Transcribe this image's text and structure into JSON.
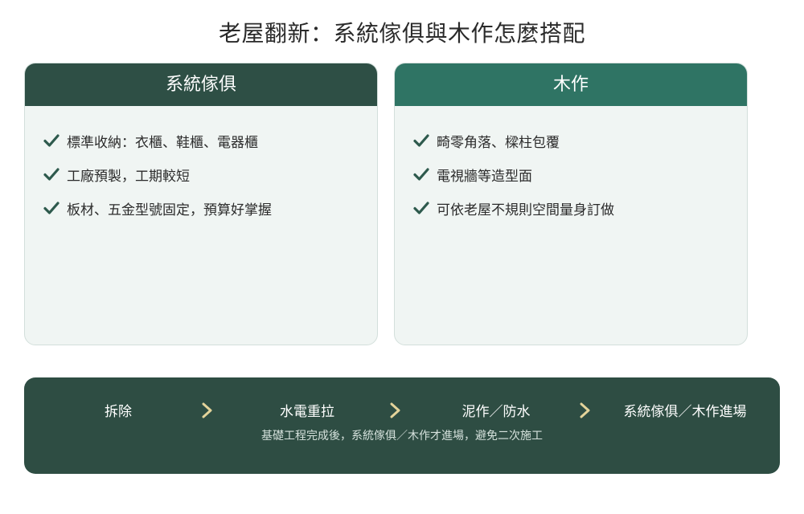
{
  "title": "老屋翻新：系統傢俱與木作怎麼搭配",
  "cards": [
    {
      "heading": "系統傢俱",
      "items": [
        "標準收納：衣櫃、鞋櫃、電器櫃",
        "工廠預製，工期較短",
        "板材、五金型號固定，預算好掌握"
      ]
    },
    {
      "heading": "木作",
      "items": [
        "畸零角落、樑柱包覆",
        "電視牆等造型面",
        "可依老屋不規則空間量身訂做"
      ]
    }
  ],
  "flow": {
    "steps": [
      "拆除",
      "水電重拉",
      "泥作／防水",
      "系統傢俱／木作進場"
    ],
    "note": "基礎工程完成後，系統傢俱／木作才進場，避免二次施工"
  },
  "icons": {
    "list_marker": "check-icon",
    "flow_separator": "chevron-right-icon"
  },
  "colors": {
    "system_header": "#2e4f45",
    "woodwork_header": "#2f7464",
    "check": "#2e5a4d",
    "flow_background": "#2e4d43",
    "arrow": "#e3d39a"
  }
}
